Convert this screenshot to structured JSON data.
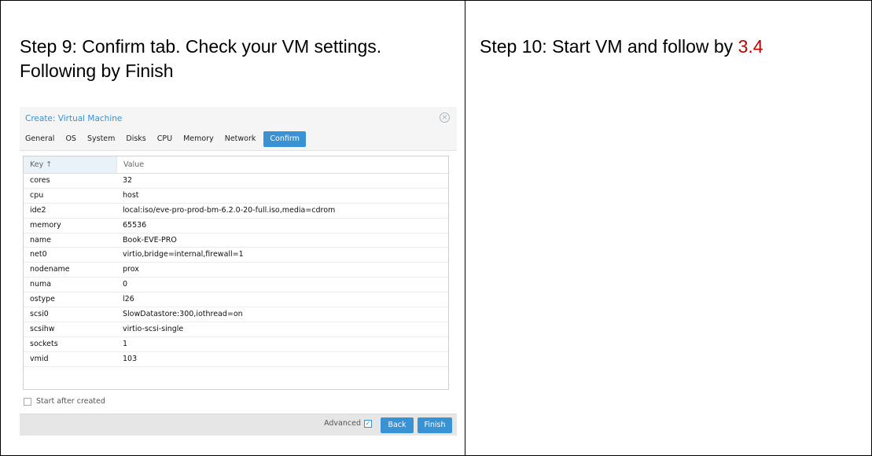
{
  "left_cell": {
    "step_text": "Step 9: Confirm tab. Check your VM settings. Following by Finish"
  },
  "right_cell": {
    "step_text": "Step 10: Start VM and follow by ",
    "reference": "3.4",
    "reference_color": "#c00000"
  },
  "dialog": {
    "title": "Create: Virtual Machine",
    "close_icon": "close-icon",
    "tabs": [
      "General",
      "OS",
      "System",
      "Disks",
      "CPU",
      "Memory",
      "Network",
      "Confirm"
    ],
    "active_tab": "Confirm",
    "accent_color": "#3892d4",
    "grid": {
      "key_header": "Key ↑",
      "value_header": "Value",
      "rows": [
        {
          "key": "cores",
          "value": "32"
        },
        {
          "key": "cpu",
          "value": "host"
        },
        {
          "key": "ide2",
          "value": "local:iso/eve-pro-prod-bm-6.2.0-20-full.iso,media=cdrom"
        },
        {
          "key": "memory",
          "value": "65536"
        },
        {
          "key": "name",
          "value": "Book-EVE-PRO"
        },
        {
          "key": "net0",
          "value": "virtio,bridge=internal,firewall=1"
        },
        {
          "key": "nodename",
          "value": "prox"
        },
        {
          "key": "numa",
          "value": "0"
        },
        {
          "key": "ostype",
          "value": "l26"
        },
        {
          "key": "scsi0",
          "value": "SlowDatastore:300,iothread=on"
        },
        {
          "key": "scsihw",
          "value": "virtio-scsi-single"
        },
        {
          "key": "sockets",
          "value": "1"
        },
        {
          "key": "vmid",
          "value": "103"
        }
      ]
    },
    "start_after_created": {
      "label": "Start after created",
      "checked": false
    },
    "advanced": {
      "label": "Advanced",
      "checked": true
    },
    "back_label": "Back",
    "finish_label": "Finish"
  }
}
